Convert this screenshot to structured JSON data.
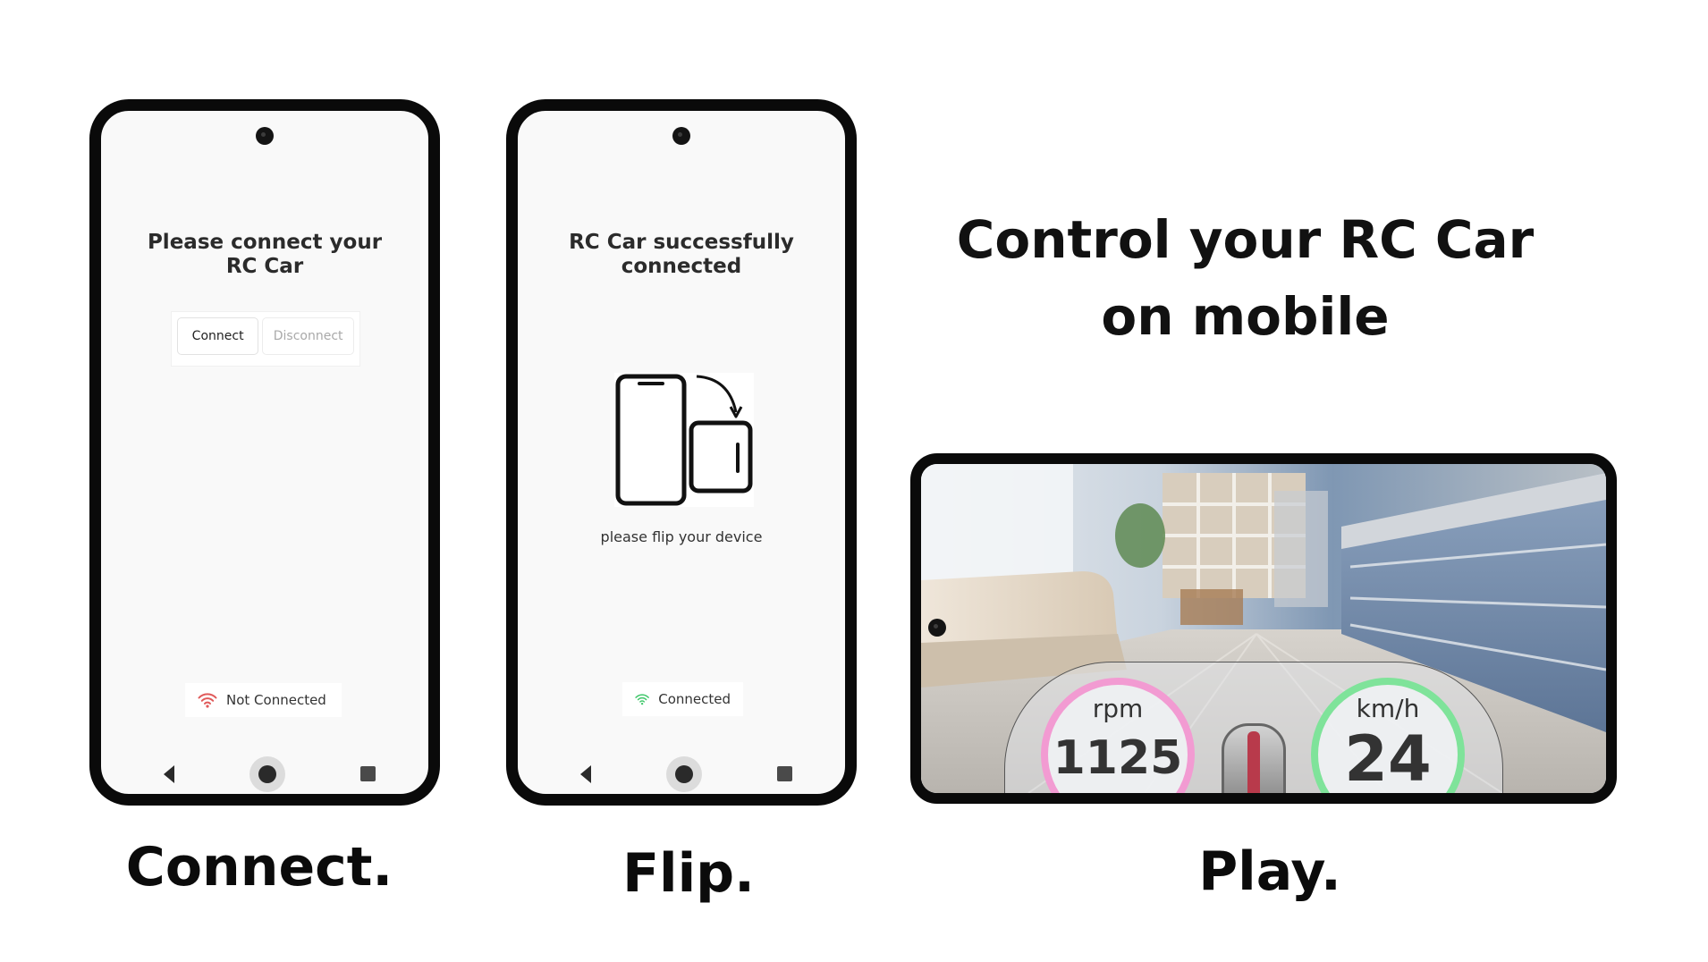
{
  "headline": "Control your RC Car\non mobile",
  "steps": {
    "connect": "Connect.",
    "flip": "Flip.",
    "play": "Play."
  },
  "phone_connect": {
    "title": "Please connect your\nRC Car",
    "connect_button": "Connect",
    "disconnect_button": "Disconnect",
    "status_text": "Not Connected",
    "status_icon": "wifi-off-icon",
    "status_color": "#e05a5a"
  },
  "phone_flip": {
    "title": "RC Car successfully\nconnected",
    "instruction": "please flip your device",
    "status_text": "Connected",
    "status_icon": "wifi-icon",
    "status_color": "#3fc76a"
  },
  "phone_play": {
    "rpm_unit": "rpm",
    "rpm_value": "1125",
    "rpm_ring_color": "#f29bd2",
    "speed_unit": "km/h",
    "speed_value": "24",
    "speed_ring_color": "#7fe39a"
  }
}
